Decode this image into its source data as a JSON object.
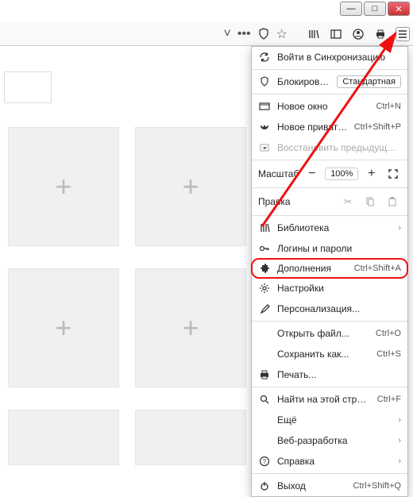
{
  "window": {
    "minimize": "—",
    "maximize": "□",
    "close": "✕"
  },
  "urlbar": {
    "chevron": "˅",
    "dots": "•••",
    "shield": "◯",
    "star": "☆"
  },
  "toolbar": {
    "library": "▥",
    "sidebar": "▣",
    "account": "◉",
    "print": "⎙"
  },
  "menu": {
    "sync": "Войти в Синхронизацию",
    "blocking": "Блокировка содержимого",
    "blocking_badge": "Стандартная",
    "new_window": "Новое окно",
    "new_window_sc": "Ctrl+N",
    "new_private": "Новое приватное окно",
    "new_private_sc": "Ctrl+Shift+P",
    "restore": "Восстановить предыдущую сессию",
    "zoom_label": "Масштаб",
    "zoom_value": "100%",
    "edit_label": "Правка",
    "library": "Библиотека",
    "logins": "Логины и пароли",
    "addons": "Дополнения",
    "addons_sc": "Ctrl+Shift+A",
    "settings": "Настройки",
    "customize": "Персонализация...",
    "open_file": "Открыть файл...",
    "open_file_sc": "Ctrl+O",
    "save_as": "Сохранить как...",
    "save_as_sc": "Ctrl+S",
    "print": "Печать...",
    "find": "Найти на этой странице...",
    "find_sc": "Ctrl+F",
    "more": "Ещё",
    "webdev": "Веб-разработка",
    "help": "Справка",
    "exit": "Выход",
    "exit_sc": "Ctrl+Shift+Q"
  },
  "tile_plus": "+"
}
